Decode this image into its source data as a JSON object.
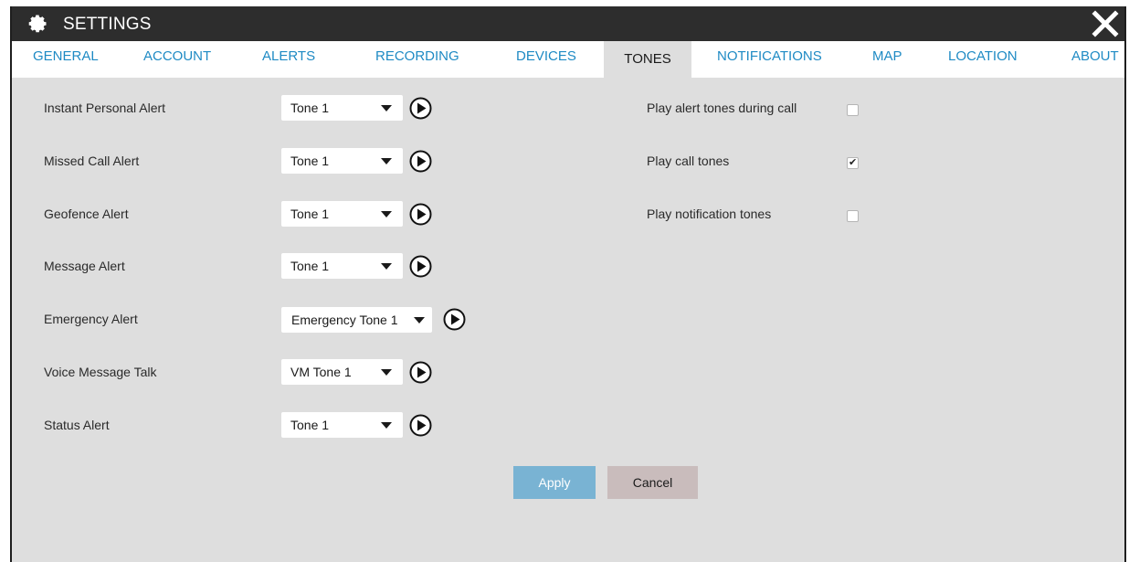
{
  "window": {
    "title": "SETTINGS",
    "title_icon": "gear-icon",
    "close_icon": "close-icon"
  },
  "tabs": [
    {
      "label": "GENERAL",
      "active": false
    },
    {
      "label": "ACCOUNT",
      "active": false
    },
    {
      "label": "ALERTS",
      "active": false
    },
    {
      "label": "RECORDING",
      "active": false
    },
    {
      "label": "DEVICES",
      "active": false
    },
    {
      "label": "TONES",
      "active": true
    },
    {
      "label": "NOTIFICATIONS",
      "active": false
    },
    {
      "label": "MAP",
      "active": false
    },
    {
      "label": "LOCATION",
      "active": false
    },
    {
      "label": "ABOUT",
      "active": false
    }
  ],
  "tone_settings": [
    {
      "label": "Instant Personal Alert",
      "value": "Tone 1"
    },
    {
      "label": "Missed Call Alert",
      "value": "Tone 1"
    },
    {
      "label": "Geofence Alert",
      "value": "Tone 1"
    },
    {
      "label": "Message Alert",
      "value": "Tone 1"
    },
    {
      "label": "Emergency Alert",
      "value": "Emergency Tone 1"
    },
    {
      "label": "Voice Message Talk",
      "value": "VM Tone 1"
    },
    {
      "label": "Status Alert",
      "value": "Tone 1"
    }
  ],
  "options": [
    {
      "label": "Play alert tones during call",
      "checked": false
    },
    {
      "label": "Play call tones",
      "checked": true
    },
    {
      "label": "Play notification tones",
      "checked": false
    }
  ],
  "buttons": {
    "apply_label": "Apply",
    "cancel_label": "Cancel"
  },
  "colors": {
    "titlebar": "#2d2d2d",
    "tab_link": "#1e8ac4",
    "panel_bg": "#dedede",
    "apply_bg": "#79b3d3",
    "cancel_bg": "#c9bcbc"
  }
}
